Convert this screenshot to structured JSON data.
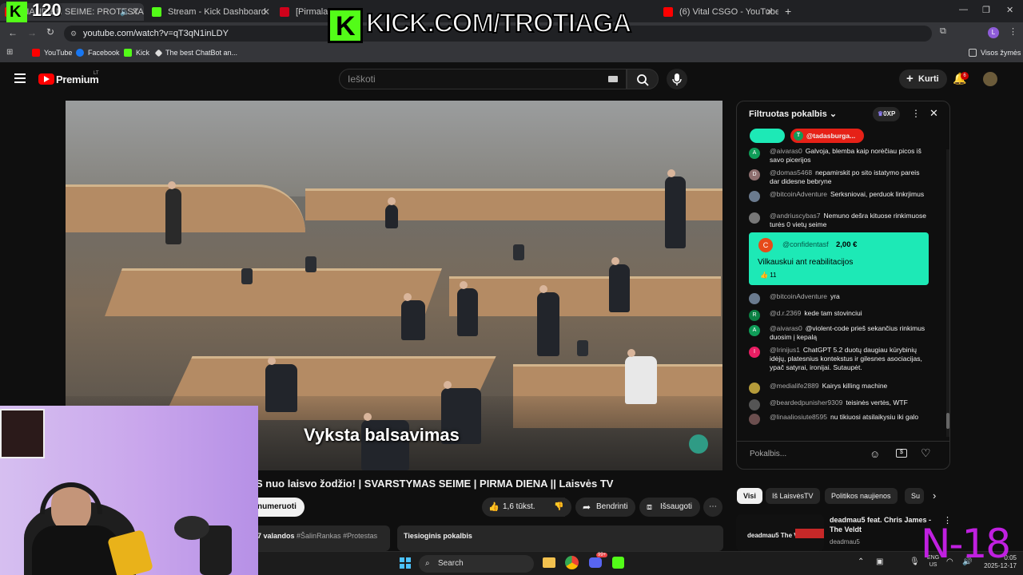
{
  "browser": {
    "tabs": [
      {
        "label": "ŠIANDIEN SEIME: PROTESTAS",
        "color": "#ff0000"
      },
      {
        "label": "Stream - Kick Dashboard",
        "color": "#53fc18"
      },
      {
        "label": "[Pirmalaikiai",
        "color": "#d0021b"
      },
      {
        "label": "(6) Vital CSGO - YouTube",
        "color": "#ff0000"
      }
    ],
    "url": "youtube.com/watch?v=qT3qN1inLDY",
    "bookmarks": [
      "YouTube",
      "Facebook",
      "Kick",
      "The best ChatBot an..."
    ],
    "bookmarks_folder": "Visos žymės",
    "profile_initial": "L"
  },
  "overlay": {
    "kick_url": "KICK.COM/TROTIAGA",
    "viewer_count": "120",
    "age_rating": "N-18"
  },
  "youtube": {
    "logo": "Premium",
    "region": "LT",
    "search_placeholder": "Ieškoti",
    "create_label": "Kurti",
    "notification_count": "6"
  },
  "video": {
    "subtitle": "Vyksta balsavimas",
    "title": "S nuo laisvo žodžio! | SVARSTYMAS SEIME | PIRMA DIENA || Laisvės TV",
    "subscribe_label": "numeruoti",
    "likes": "1,6 tūkst.",
    "share_label": "Bendrinti",
    "save_label": "Išsaugoti",
    "desc_time": "7 valandos",
    "desc_tags": "#ŠalinRankas #Protestas",
    "live_chat_label": "Tiesioginis pokalbis"
  },
  "chat": {
    "header": "Filtruotas pokalbis",
    "xp": "0XP",
    "pinned_user": "@tadasburga...",
    "input_placeholder": "Pokalbis...",
    "messages": [
      {
        "author": "@aivaras0",
        "text": "Galvoja, blemba kaip norėčiau picos iš savo picerijos",
        "avatar": "A",
        "color": "#0f9d58"
      },
      {
        "author": "@domas5468",
        "text": "nepamirskit po sito istatymo pareis dar didesne bebryne",
        "avatar": "D",
        "color": "#8e6e6e"
      },
      {
        "author": "@bitcoinAdventure",
        "text": "Serksniovai, perduok linkrjimus",
        "avatar": "",
        "color": "#6a7a8e"
      },
      {
        "author": "@andriuscybas7",
        "text": "Nemuno dešra kituose rinkimuose turės 0 vietų seime",
        "avatar": "",
        "color": "#777"
      },
      {
        "author": "@bitcoinAdventure",
        "text": "yra",
        "avatar": "",
        "color": "#6a7a8e"
      },
      {
        "author": "@d.r.2369",
        "text": "kede tam stovinciui",
        "avatar": "R",
        "color": "#0b8043"
      },
      {
        "author": "@aivaras0",
        "text": "@violent-code prieš sekančius rinkimus duosim į kepalą",
        "avatar": "A",
        "color": "#0f9d58"
      },
      {
        "author": "@Irinijus1",
        "text": "ChatGPT 5.2 duotų daugiau kūrybinių idėjų, platesnius kontekstus ir gilesnes asociacijas, ypač satyrai, ironijai. Sutaupėt.",
        "avatar": "I",
        "color": "#e91e63"
      },
      {
        "author": "@medialife2889",
        "text": "Kairys killing machine",
        "avatar": "",
        "color": "#b59b3a"
      },
      {
        "author": "@beardedpunisher9309",
        "text": "teisinės vertės, WTF",
        "avatar": "",
        "color": "#555"
      },
      {
        "author": "@linaaliosiute8595",
        "text": "nu tikiuosi atsilaikysiu iki galo",
        "avatar": "",
        "color": "#6b4e4e"
      }
    ],
    "superchat": {
      "author": "@confidentasf",
      "amount": "2,00 €",
      "text": "Vilkauskui ant reabilitacijos",
      "likes": "11",
      "avatar": "C"
    }
  },
  "related": {
    "chips": [
      "Visi",
      "Iš LaisvėsTV",
      "Politikos naujienos",
      "Su"
    ],
    "video_title": "deadmau5 feat. Chris James - The Veldt",
    "video_channel": "deadmau5",
    "thumb_text": "deadmau5 The Veldt"
  },
  "taskbar": {
    "search_label": "Search",
    "lang": "ENG",
    "region": "US",
    "time": "0:05",
    "date": "2025-12-17",
    "discord_badge": "99+"
  }
}
